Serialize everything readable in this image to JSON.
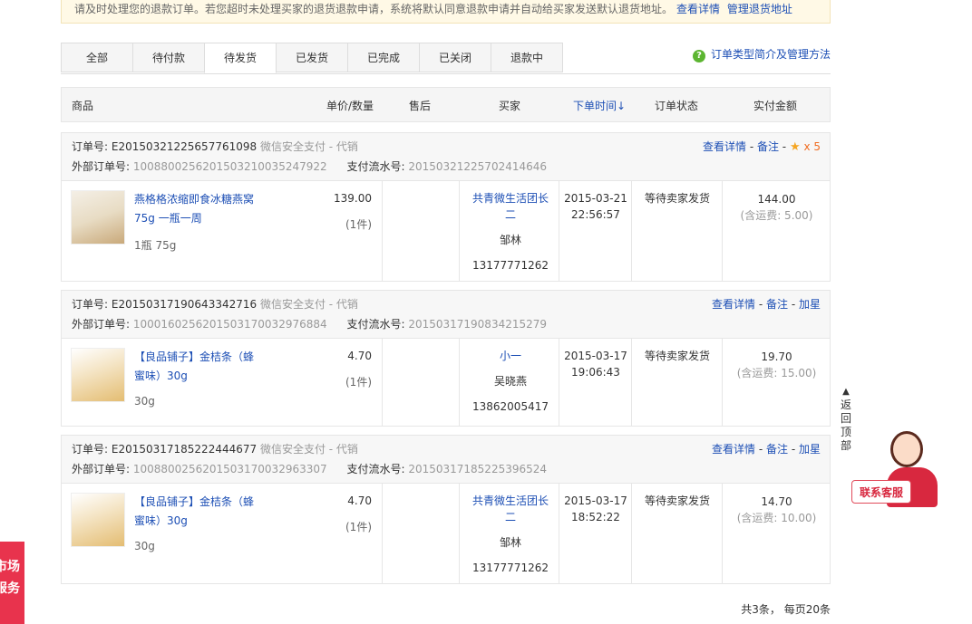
{
  "notice": {
    "text": "请及时处理您的退款订单。若您超时未处理买家的退货退款申请，系统将默认同意退款申请并自动给买家发送默认退货地址。",
    "link1": "查看详情",
    "link2": "管理退货地址"
  },
  "tabs": [
    "全部",
    "待付款",
    "待发货",
    "已发货",
    "已完成",
    "已关闭",
    "退款中"
  ],
  "active_tab": "待发货",
  "help_link": "订单类型简介及管理方法",
  "table_header": {
    "product": "商品",
    "price_qty": "单价/数量",
    "after_sale": "售后",
    "buyer": "买家",
    "order_time": "下单时间↓",
    "status": "订单状态",
    "amount": "实付金额"
  },
  "orders": [
    {
      "order_no_label": "订单号: E20150321225657761098",
      "payment": "微信安全支付 - 代销",
      "external_label": "外部订单号: ",
      "external_no": "1008800256201503210035247922",
      "flow_label": "支付流水号: ",
      "flow_no": "201503212257024146​46",
      "action_detail": "查看详情",
      "action_remark": "备注",
      "action_star": "★",
      "action_extra": "x 5",
      "product_name": "燕格格浓缩即食冰糖燕窝75g 一瓶一周",
      "product_spec": "1瓶 75g",
      "price": "139.00",
      "qty": "(1件)",
      "buyer_shop": "共青微生活团长二",
      "buyer_name": "邹林",
      "buyer_phone": "13177771262",
      "date": "2015-03-21",
      "time": "22:56:57",
      "status": "等待卖家发货",
      "amount": "144.00",
      "shipping": "(含运费: 5.00)"
    },
    {
      "order_no_label": "订单号: E20150317190643342716",
      "payment": "微信安全支付 - 代销",
      "external_label": "外部订单号: ",
      "external_no": "1000160256201503170032976884",
      "flow_label": "支付流水号: ",
      "flow_no": "201503171908​34215279",
      "action_detail": "查看详情",
      "action_remark": "备注",
      "action_extra": "加星",
      "product_name": "【良品铺子】金桔条（蜂蜜味）30g",
      "product_spec": "30g",
      "price": "4.70",
      "qty": "(1件)",
      "buyer_shop": "小一",
      "buyer_name": "吴晓燕",
      "buyer_phone": "13862005417",
      "date": "2015-03-17",
      "time": "19:06:43",
      "status": "等待卖家发货",
      "amount": "19.70",
      "shipping": "(含运费: 15.00)"
    },
    {
      "order_no_label": "订单号: E20150317185222444677",
      "payment": "微信安全支付 - 代销",
      "external_label": "外部订单号: ",
      "external_no": "1008800256201503170032963307",
      "flow_label": "支付流水号: ",
      "flow_no": "201503171852​25396524",
      "action_detail": "查看详情",
      "action_remark": "备注",
      "action_extra": "加星",
      "product_name": "【良品铺子】金桔条（蜂蜜味）30g",
      "product_spec": "30g",
      "price": "4.70",
      "qty": "(1件)",
      "buyer_shop": "共青微生活团长二",
      "buyer_name": "邹林",
      "buyer_phone": "13177771262",
      "date": "2015-03-17",
      "time": "18:52:22",
      "status": "等待卖家发货",
      "amount": "14.70",
      "shipping": "(含运费: 10.00)"
    }
  ],
  "pager": "共3条， 每页20条",
  "back_to_top": "返回顶部",
  "contact_service": "联系客服",
  "market_service": "市场服务"
}
